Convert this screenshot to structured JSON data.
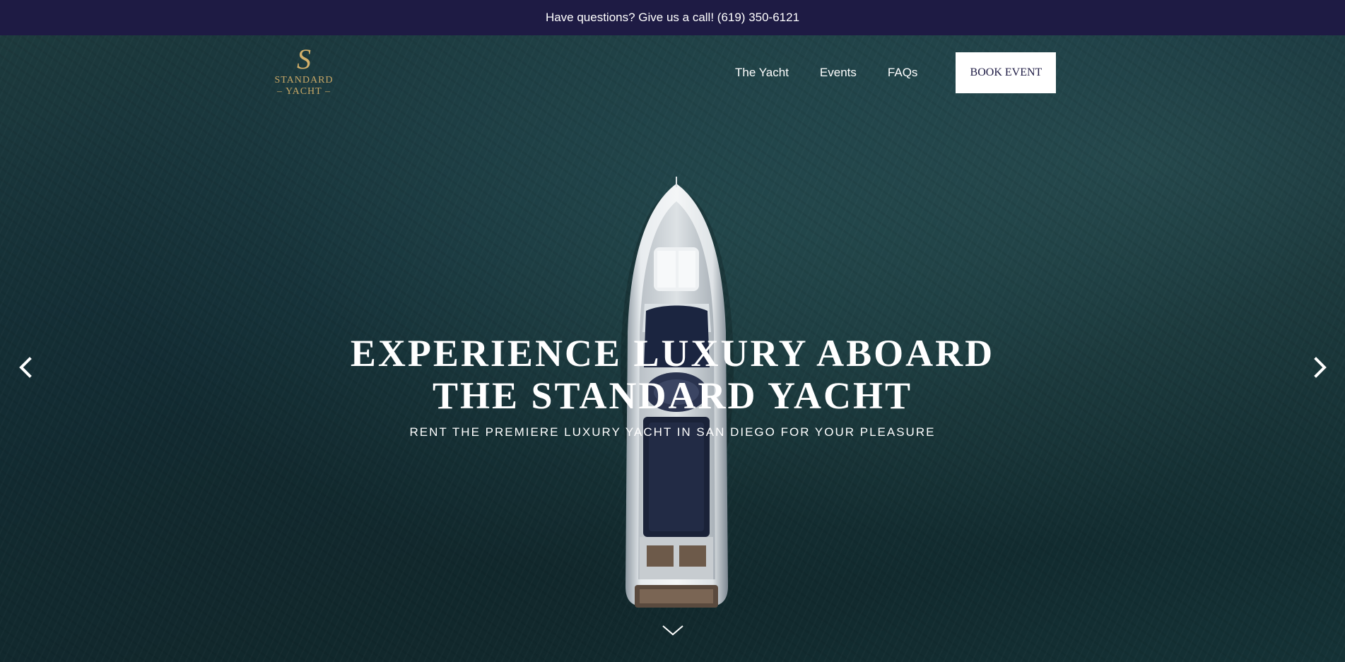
{
  "topbar": {
    "text": "Have questions? Give us a call! (619) 350-6121"
  },
  "logo": {
    "mark": "S",
    "line1": "STANDARD",
    "line2": "– YACHT –"
  },
  "nav": {
    "items": [
      {
        "label": "The Yacht"
      },
      {
        "label": "Events"
      },
      {
        "label": "FAQs"
      }
    ],
    "cta": "BOOK EVENT"
  },
  "hero": {
    "title": "EXPERIENCE LUXURY ABOARD THE STANDARD YACHT",
    "subtitle": "RENT THE PREMIERE LUXURY YACHT IN SAN DIEGO FOR YOUR PLEASURE"
  },
  "icons": {
    "prev": "chevron-left-icon",
    "next": "chevron-right-icon",
    "scroll": "chevron-down-icon"
  },
  "colors": {
    "topbar_bg": "#1e1b44",
    "logo_gold": "#c9a866",
    "water": "#10272b",
    "cta_text": "#1e1b44"
  }
}
